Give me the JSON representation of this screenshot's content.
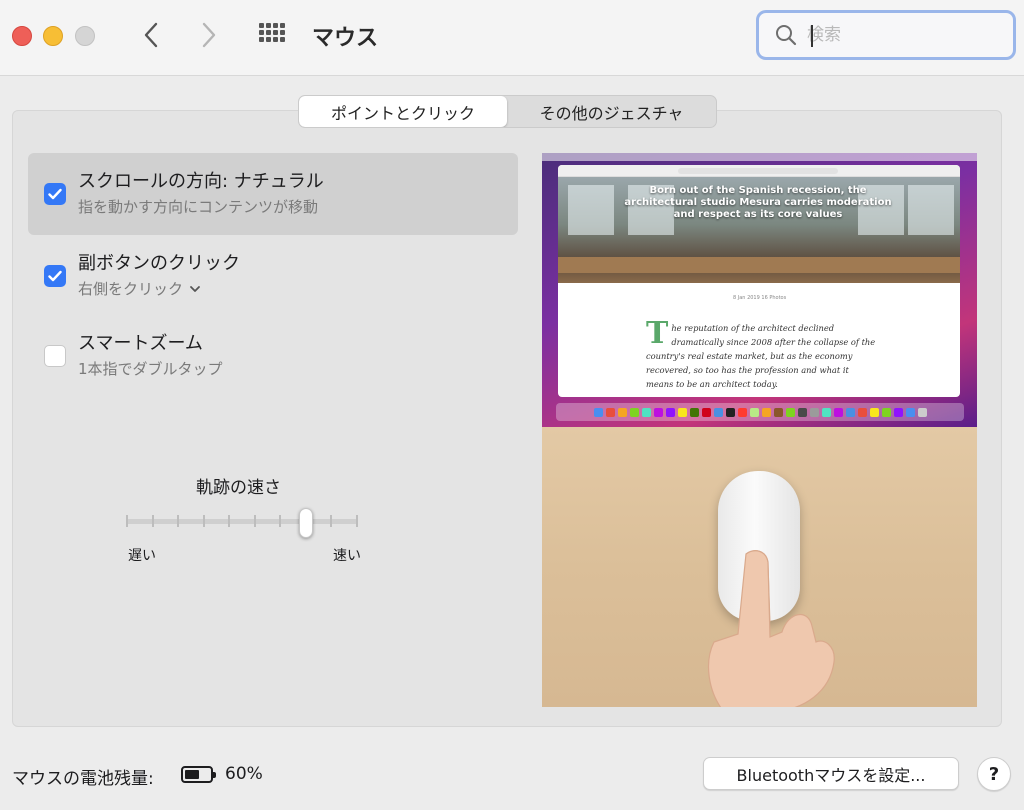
{
  "window": {
    "title": "マウス"
  },
  "search": {
    "placeholder": "検索",
    "value": ""
  },
  "tabs": [
    {
      "label": "ポイントとクリック",
      "active": true
    },
    {
      "label": "その他のジェスチャ",
      "active": false
    }
  ],
  "options": [
    {
      "title": "スクロールの方向: ナチュラル",
      "subtitle": "指を動かす方向にコンテンツが移動",
      "checked": true
    },
    {
      "title": "副ボタンのクリック",
      "subtitle": "右側をクリック",
      "checked": true
    },
    {
      "title": "スマートズーム",
      "subtitle": "1本指でダブルタップ",
      "checked": false
    }
  ],
  "tracking_speed": {
    "label": "軌跡の速さ",
    "min_label": "遅い",
    "max_label": "速い",
    "tick_count": 10,
    "value_index": 7
  },
  "preview": {
    "headline": "Born out of the Spanish recession, the architectural studio Mesura carries moderation and respect as its core values",
    "meta": "8 Jan 2019    16 Photos",
    "dropcap": "T",
    "article": "he reputation of the architect declined dramatically since 2008 after the collapse of the country's real estate market, but as the economy recovered, so too has the profession and what it means to be an architect today."
  },
  "battery": {
    "label": "マウスの電池残量:",
    "value": "60%",
    "level": 0.6
  },
  "bluetooth_button": {
    "label": "Bluetoothマウスを設定..."
  },
  "help_button": {
    "label": "?"
  },
  "colors": {
    "accent": "#3478f6",
    "close": "#ee5f58",
    "minimize": "#f7be35"
  }
}
